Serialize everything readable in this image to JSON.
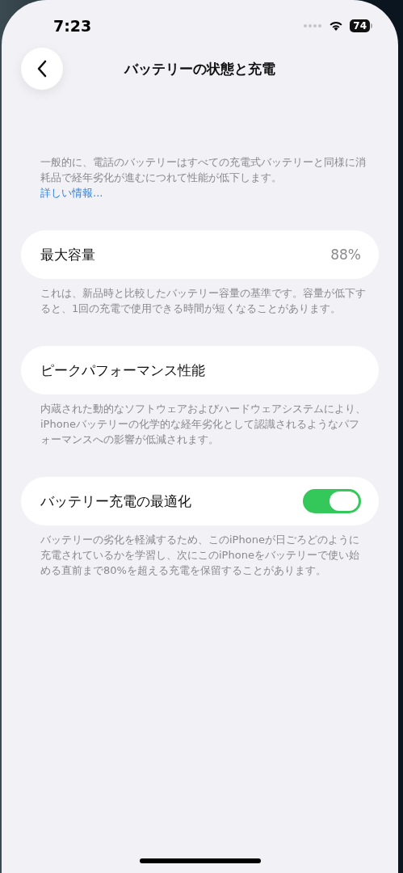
{
  "status_bar": {
    "time": "7:23",
    "battery": "74"
  },
  "nav": {
    "title": "バッテリーの状態と充電"
  },
  "intro": {
    "text": "一般的に、電話のバッテリーはすべての充電式バッテリーと同様に消耗品で経年劣化が進むにつれて性能が低下します。",
    "link": "詳しい情報..."
  },
  "sections": [
    {
      "kind": "value",
      "label": "最大容量",
      "value": "88%",
      "footer": "これは、新品時と比較したバッテリー容量の基準です。容量が低下すると、1回の充電で使用できる時間が短くなることがあります。"
    },
    {
      "kind": "plain",
      "label": "ピークパフォーマンス性能",
      "footer": "内蔵された動的なソフトウェアおよびハードウェアシステムにより、iPhoneバッテリーの化学的な経年劣化として認識されるようなパフォーマンスへの影響が低減されます。"
    },
    {
      "kind": "toggle",
      "label": "バッテリー充電の最適化",
      "on": true,
      "footer": "バッテリーの劣化を軽減するため、このiPhoneが日ごろどのように充電されているかを学習し、次にこのiPhoneをバッテリーで使い始める直前まで80%を超える充電を保留することがあります。"
    }
  ]
}
